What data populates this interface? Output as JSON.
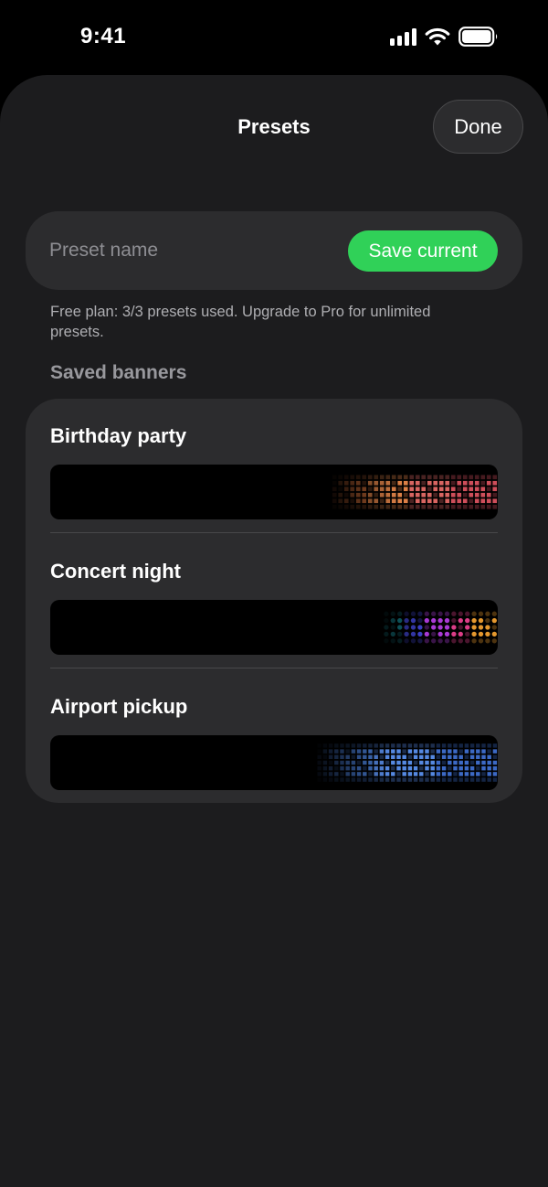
{
  "status_bar": {
    "time": "9:41"
  },
  "sheet": {
    "title": "Presets",
    "done_label": "Done"
  },
  "name_field": {
    "placeholder": "Preset name",
    "save_label": "Save current"
  },
  "plan_note": "Free plan: 3/3 presets used. Upgrade to Pro for unlimited presets.",
  "section_header": "Saved banners",
  "presets": [
    {
      "name": "Birthday party",
      "palette": [
        "#e0763c",
        "#e8874a",
        "#e46a66",
        "#d9525f"
      ],
      "dot_shape": "square"
    },
    {
      "name": "Concert night",
      "palette": [
        "#21c7d9",
        "#4b4ff2",
        "#b23de0",
        "#e8408e",
        "#f0a030"
      ],
      "dot_shape": "round"
    },
    {
      "name": "Airport pickup",
      "palette": [
        "#4e86e6",
        "#5a90ee",
        "#3f6fd0"
      ],
      "dot_shape": "square"
    }
  ],
  "colors": {
    "accent_green": "#30d158",
    "sheet_bg": "#1c1c1e",
    "card_bg": "#2c2c2e"
  }
}
